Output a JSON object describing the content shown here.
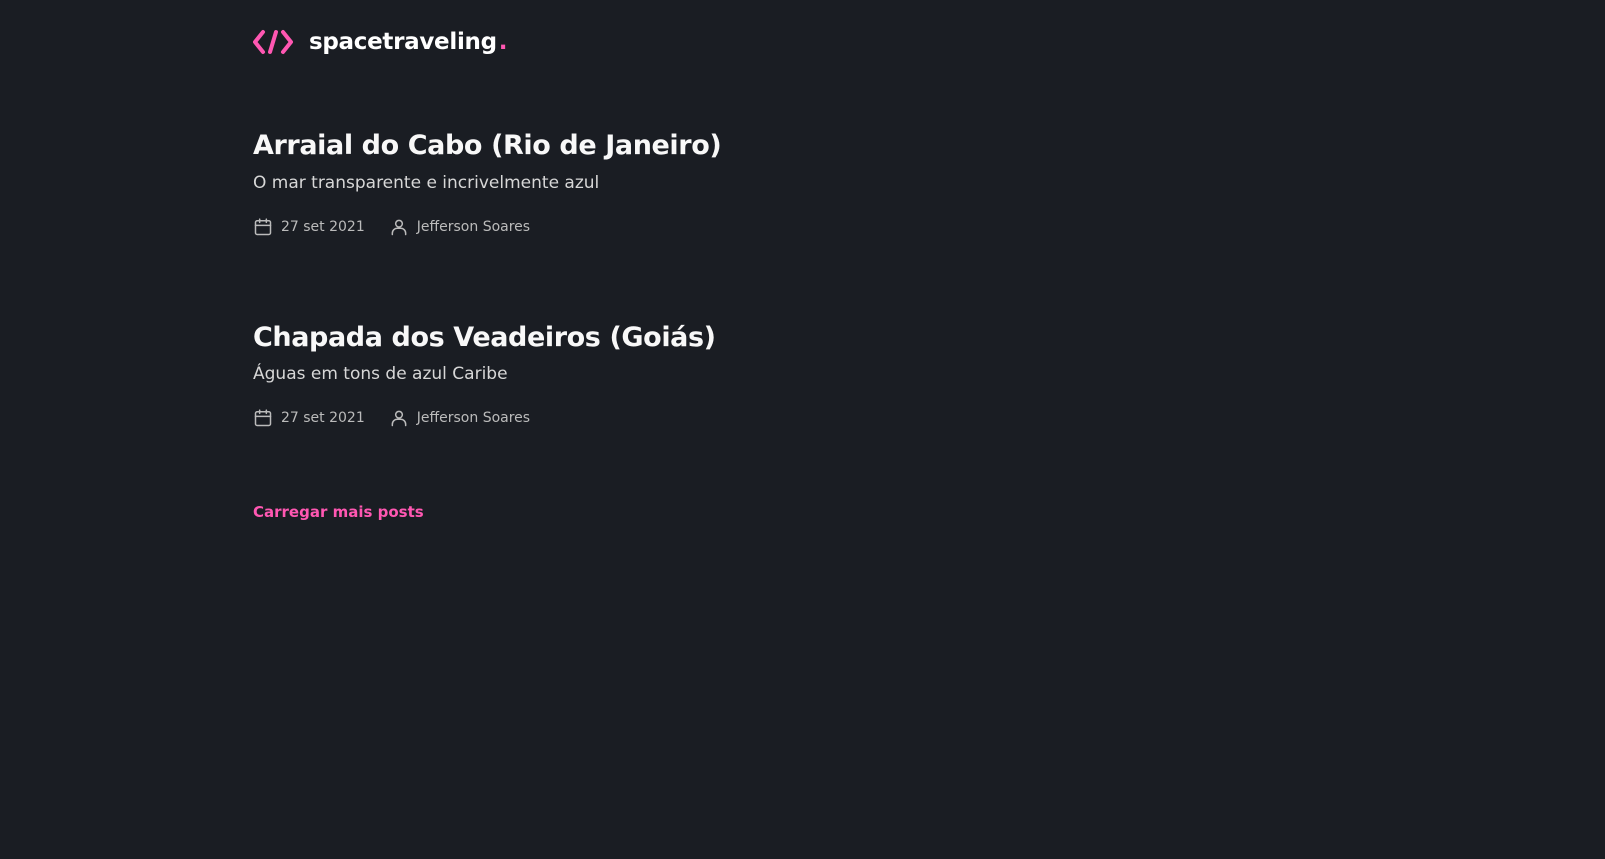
{
  "header": {
    "logo_text": "spacetraveling",
    "logo_dot": ".",
    "logo_icon": "code-brackets-icon",
    "accent_color": "#ff57b2"
  },
  "posts": [
    {
      "title": "Arraial do Cabo (Rio de Janeiro)",
      "subtitle": "O mar transparente e incrivelmente azul",
      "date": "27 set 2021",
      "author": "Jefferson Soares"
    },
    {
      "title": "Chapada dos Veadeiros (Goiás)",
      "subtitle": "Águas em tons de azul Caribe",
      "date": "27 set 2021",
      "author": "Jefferson Soares"
    }
  ],
  "load_more": {
    "label": "Carregar mais posts"
  },
  "icons": {
    "date": "calendar-icon",
    "author": "user-icon"
  },
  "colors": {
    "background": "#1a1d23",
    "heading": "#f8f8f8",
    "body": "#d7d7d7",
    "info": "#bbbbbb",
    "accent": "#ff57b2"
  }
}
